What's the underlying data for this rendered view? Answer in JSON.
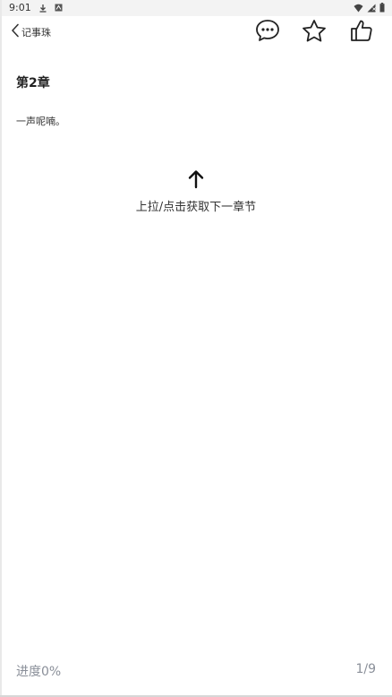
{
  "status_bar": {
    "time": "9:01",
    "left_icons": [
      "download-icon",
      "notification-icon"
    ],
    "right_icons": [
      "wifi-icon",
      "signal-icon",
      "battery-icon"
    ]
  },
  "header": {
    "back_label": "记事珠",
    "actions": [
      "comment-icon",
      "star-icon",
      "thumbs-up-icon"
    ]
  },
  "content": {
    "chapter_title": "第2章",
    "body_text": "一声呢喃。",
    "next_hint": "上拉/点击获取下一章节"
  },
  "footer": {
    "progress": "进度0%",
    "page": "1/9"
  },
  "colors": {
    "text": "#222222",
    "muted": "#8a8f99",
    "background": "#ffffff"
  }
}
